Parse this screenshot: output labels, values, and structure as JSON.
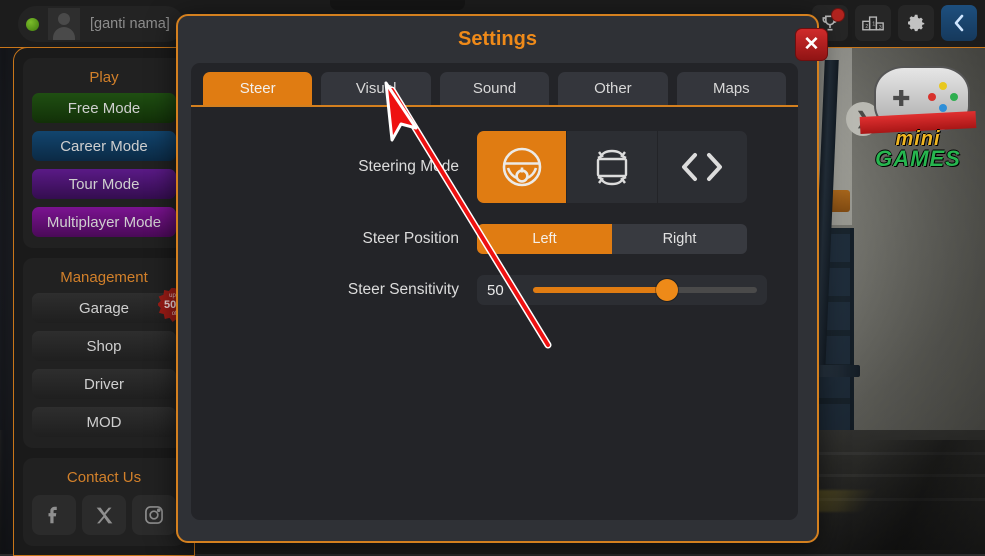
{
  "topbar": {
    "username": "[ganti nama]",
    "status": "online",
    "icons": [
      {
        "name": "trophy-icon",
        "glyph": "♛",
        "badge": true
      },
      {
        "name": "leaderboard-icon",
        "glyph": "⚑",
        "badge": false
      },
      {
        "name": "settings-gear-icon",
        "glyph": "⚙",
        "badge": false
      },
      {
        "name": "back-icon",
        "glyph": "❮",
        "badge": false
      }
    ],
    "leaderboard_ranks": [
      "2",
      "1",
      "3"
    ]
  },
  "sidebar": {
    "groups": [
      {
        "heading": "Play",
        "items": [
          {
            "label": "Free Mode",
            "style": "m-free"
          },
          {
            "label": "Career Mode",
            "style": "m-career"
          },
          {
            "label": "Tour Mode",
            "style": "m-tour"
          },
          {
            "label": "Multiplayer Mode",
            "style": "m-multi"
          }
        ]
      },
      {
        "heading": "Management",
        "items": [
          {
            "label": "Garage",
            "style": "m-plain",
            "badge_top": "upto",
            "badge_mid": "50%",
            "badge_bot": "off"
          },
          {
            "label": "Shop",
            "style": "m-plain"
          },
          {
            "label": "Driver",
            "style": "m-plain"
          },
          {
            "label": "MOD",
            "style": "m-plain"
          }
        ]
      },
      {
        "heading": "Contact Us",
        "socials": [
          {
            "name": "facebook-icon",
            "glyph": "f"
          },
          {
            "name": "x-twitter-icon",
            "glyph": "✕"
          },
          {
            "name": "instagram-icon",
            "glyph": "◎"
          }
        ]
      }
    ]
  },
  "dialog": {
    "title": "Settings",
    "close_label": "✕",
    "tabs": [
      {
        "label": "Steer",
        "active": true
      },
      {
        "label": "Visual",
        "active": false
      },
      {
        "label": "Sound",
        "active": false
      },
      {
        "label": "Other",
        "active": false
      },
      {
        "label": "Maps",
        "active": false
      }
    ],
    "rows": {
      "steering_mode": {
        "label": "Steering Mode",
        "options": [
          {
            "name": "steering-wheel-icon",
            "selected": true
          },
          {
            "name": "tilt-device-icon",
            "selected": false
          },
          {
            "name": "arrow-buttons-icon",
            "selected": false
          }
        ]
      },
      "steer_position": {
        "label": "Steer Position",
        "options": [
          {
            "label": "Left",
            "selected": true
          },
          {
            "label": "Right",
            "selected": false
          }
        ]
      },
      "steer_sensitivity": {
        "label": "Steer Sensitivity",
        "value": "50",
        "percent": 60,
        "min": 0,
        "max": 100
      }
    }
  },
  "logo": {
    "line1": "mini",
    "line2": "GAMES",
    "arrow_glyph": "❯",
    "dpad_glyph": "✚",
    "button_colors": [
      "#e8c81e",
      "#d8322c",
      "#2f8fd8",
      "#2fae4f"
    ]
  },
  "colors": {
    "accent_orange": "#e07c12",
    "title_orange": "#ef8a19",
    "border_orange": "#d4801f",
    "panel_dark": "#232428",
    "dialog_bg": "#2f3136",
    "annotation_red": "#ee1111",
    "close_red": "#cf2b2b"
  },
  "annotation": {
    "type": "arrow",
    "points_from": "548,345",
    "points_to": "390,88",
    "target": "Visual tab"
  }
}
